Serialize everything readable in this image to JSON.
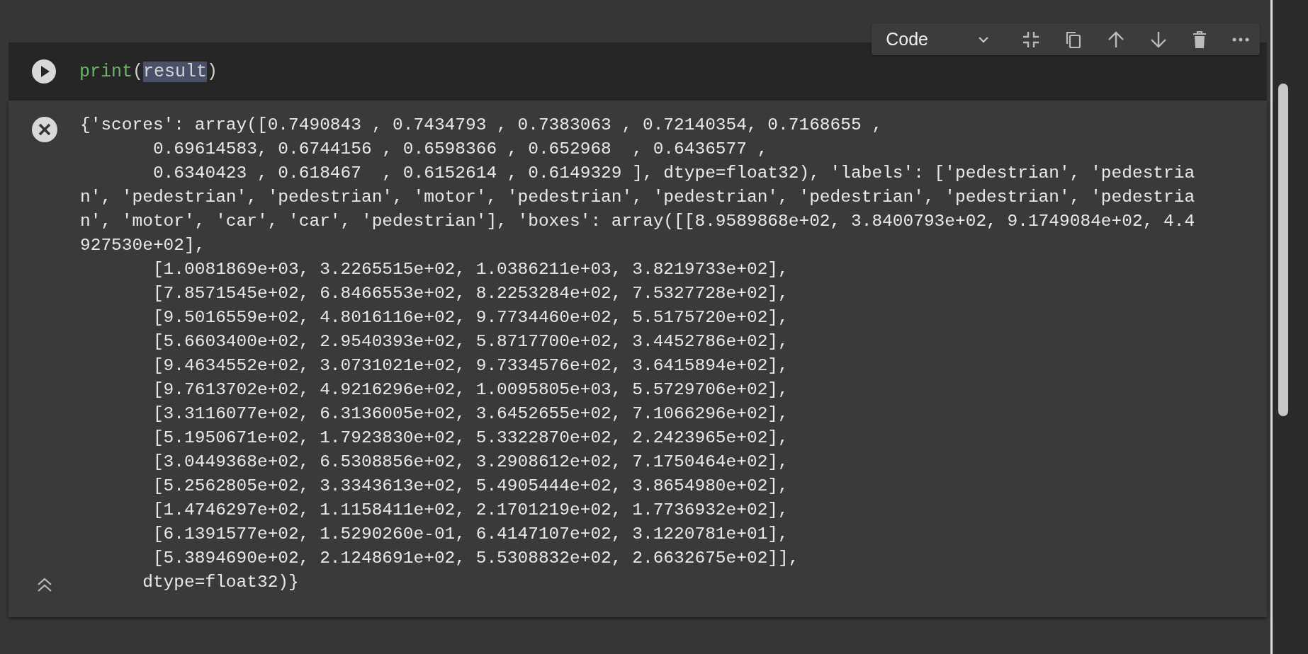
{
  "toolbar": {
    "cell_type": "Code"
  },
  "code_cell": {
    "tokens": [
      {
        "text": "print",
        "kind": "function",
        "selected": false
      },
      {
        "text": "(",
        "kind": "punct",
        "selected": false
      },
      {
        "text": "result",
        "kind": "name",
        "selected": true
      },
      {
        "text": ")",
        "kind": "punct",
        "selected": false
      }
    ]
  },
  "output": {
    "lines": [
      "{'scores': array([0.7490843 , 0.7434793 , 0.7383063 , 0.72140354, 0.7168655 ,",
      "       0.69614583, 0.6744156 , 0.6598366 , 0.652968  , 0.6436577 ,",
      "       0.6340423 , 0.618467  , 0.6152614 , 0.6149329 ], dtype=float32), 'labels': ['pedestrian', 'pedestria",
      "n', 'pedestrian', 'pedestrian', 'motor', 'pedestrian', 'pedestrian', 'pedestrian', 'pedestrian', 'pedestria",
      "n', 'motor', 'car', 'car', 'pedestrian'], 'boxes': array([[8.9589868e+02, 3.8400793e+02, 9.1749084e+02, 4.4",
      "927530e+02],",
      "       [1.0081869e+03, 3.2265515e+02, 1.0386211e+03, 3.8219733e+02],",
      "       [7.8571545e+02, 6.8466553e+02, 8.2253284e+02, 7.5327728e+02],",
      "       [9.5016559e+02, 4.8016116e+02, 9.7734460e+02, 5.5175720e+02],",
      "       [5.6603400e+02, 2.9540393e+02, 5.8717700e+02, 3.4452786e+02],",
      "       [9.4634552e+02, 3.0731021e+02, 9.7334576e+02, 3.6415894e+02],",
      "       [9.7613702e+02, 4.9216296e+02, 1.0095805e+03, 5.5729706e+02],",
      "       [3.3116077e+02, 6.3136005e+02, 3.6452655e+02, 7.1066296e+02],",
      "       [5.1950671e+02, 1.7923830e+02, 5.3322870e+02, 2.2423965e+02],",
      "       [3.0449368e+02, 6.5308856e+02, 3.2908612e+02, 7.1750464e+02],",
      "       [5.2562805e+02, 3.3343613e+02, 5.4905444e+02, 3.8654980e+02],",
      "       [1.4746297e+02, 1.1158411e+02, 2.1701219e+02, 1.7736932e+02],",
      "       [6.1391577e+02, 1.5290260e-01, 6.4147107e+02, 3.1220781e+01],",
      "       [5.3894690e+02, 2.1248691e+02, 5.5308832e+02, 2.6632675e+02]],",
      "      dtype=float32)}"
    ]
  }
}
